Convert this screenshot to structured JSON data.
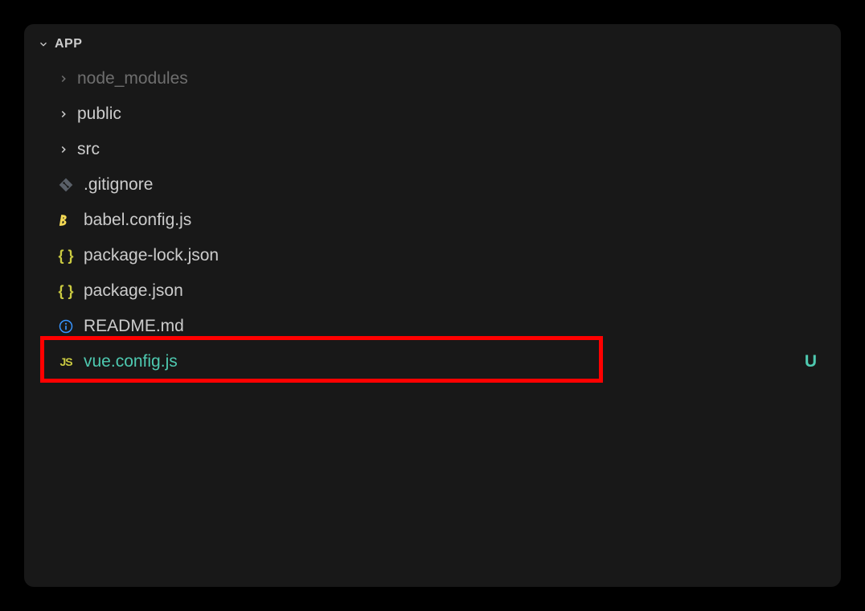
{
  "section": {
    "title": "APP"
  },
  "tree": {
    "folders": [
      {
        "name": "node_modules",
        "dimmed": true
      },
      {
        "name": "public",
        "dimmed": false
      },
      {
        "name": "src",
        "dimmed": false
      }
    ],
    "files": [
      {
        "name": ".gitignore",
        "icon": "git",
        "status": null,
        "highlighted": false
      },
      {
        "name": "babel.config.js",
        "icon": "babel",
        "status": null,
        "highlighted": false
      },
      {
        "name": "package-lock.json",
        "icon": "json",
        "status": null,
        "highlighted": false
      },
      {
        "name": "package.json",
        "icon": "json",
        "status": null,
        "highlighted": false
      },
      {
        "name": "README.md",
        "icon": "info",
        "status": null,
        "highlighted": false
      },
      {
        "name": "vue.config.js",
        "icon": "js",
        "status": "U",
        "highlighted": true
      }
    ]
  },
  "statusSymbols": {
    "untracked": "U"
  }
}
